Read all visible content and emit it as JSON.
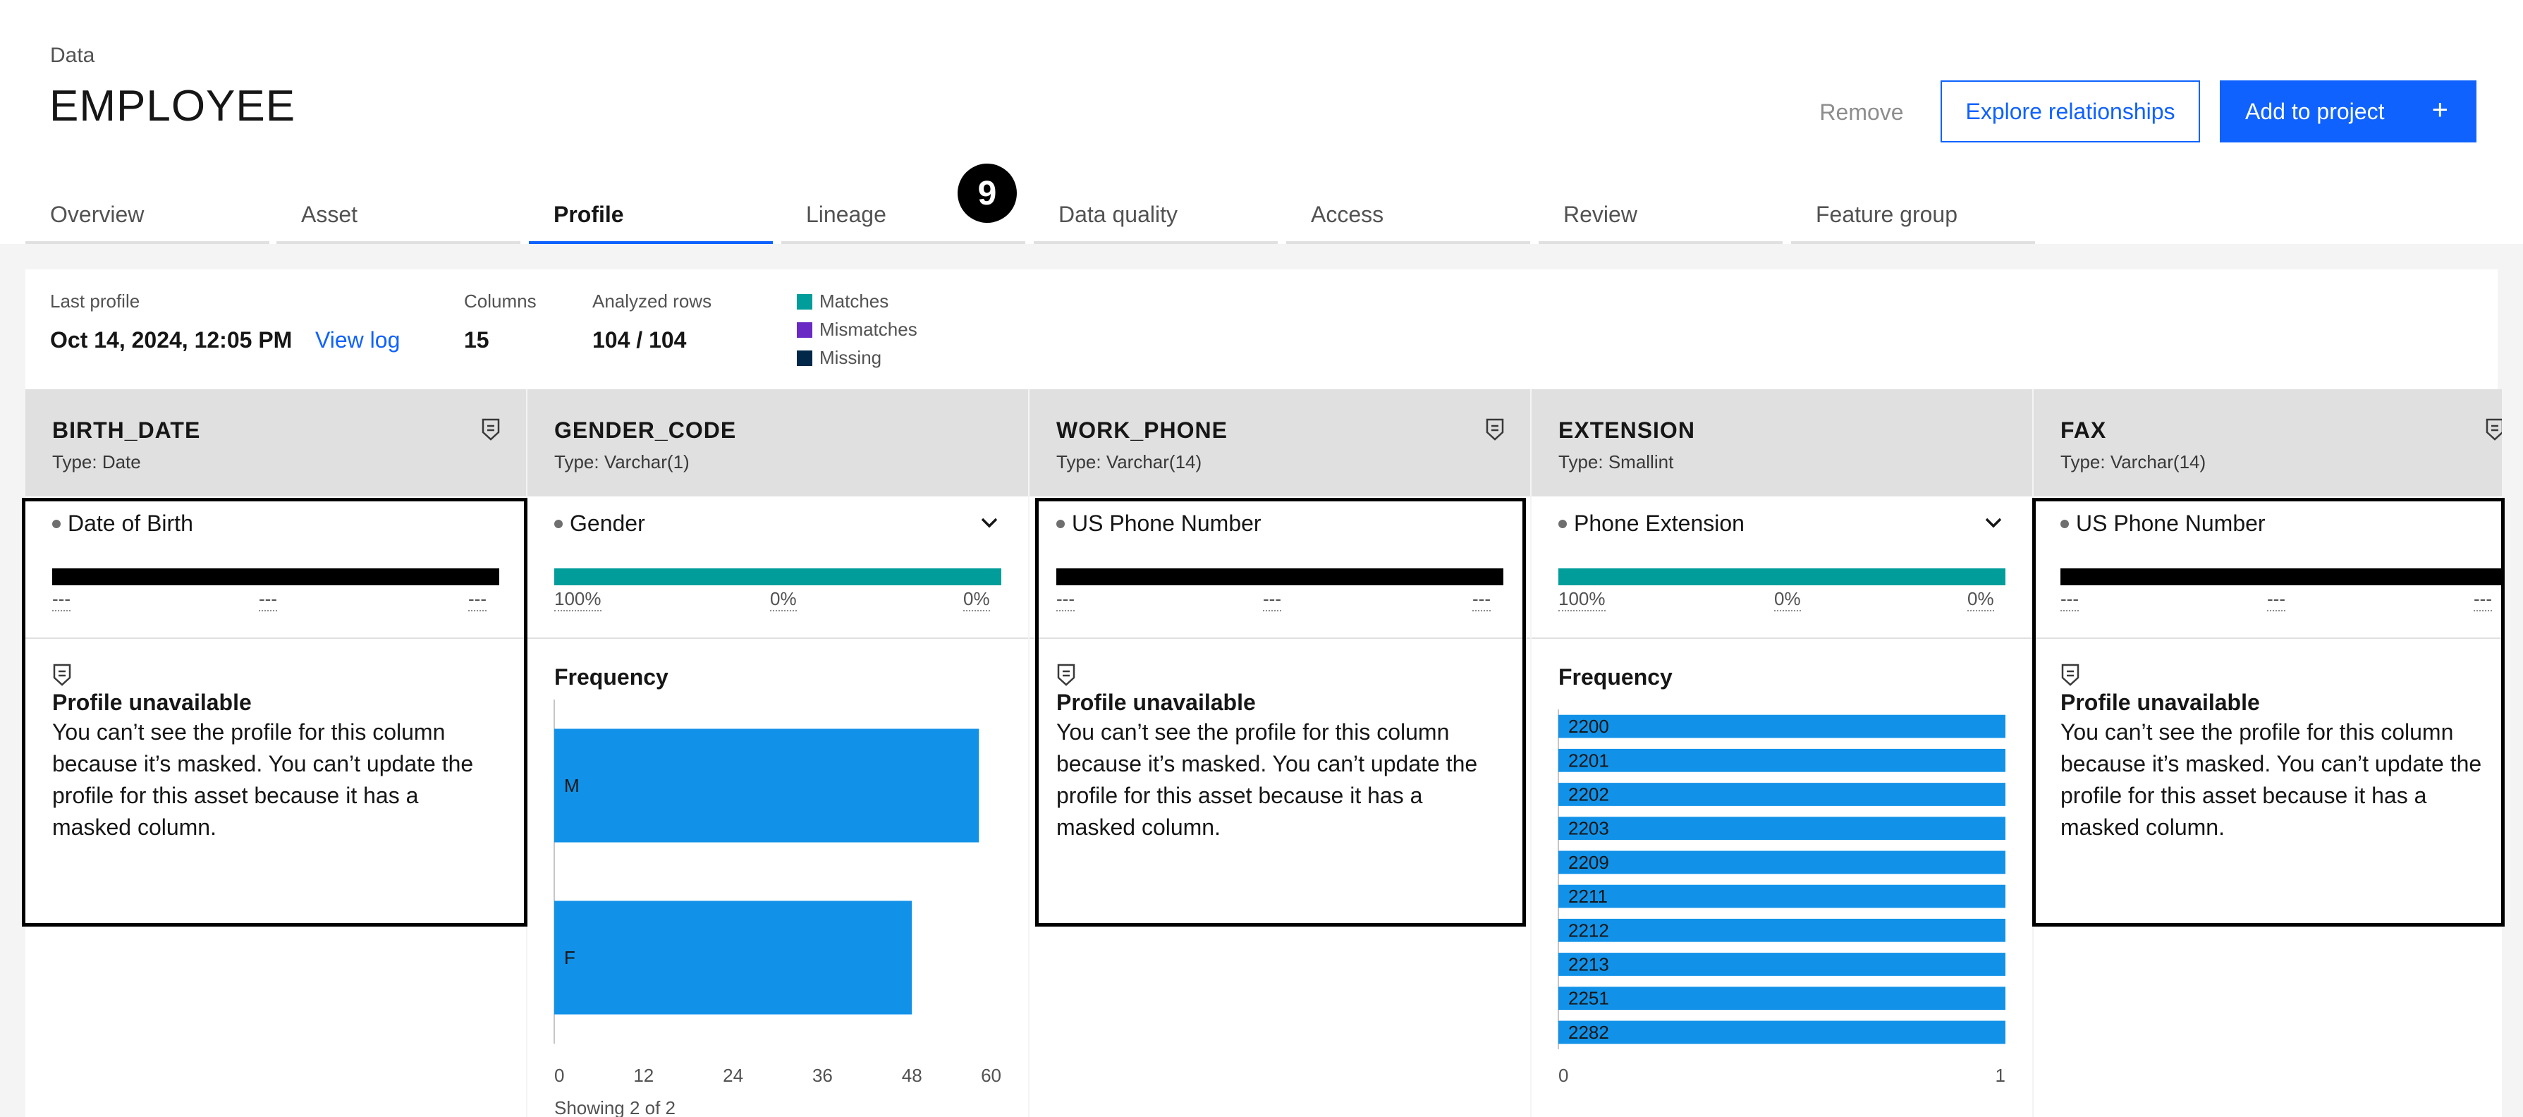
{
  "header": {
    "breadcrumb": "Data",
    "title": "EMPLOYEE",
    "remove_label": "Remove",
    "explore_label": "Explore relationships",
    "add_label": "Add to project",
    "add_icon": "+"
  },
  "tabs": [
    "Overview",
    "Asset",
    "Profile",
    "Lineage",
    "Data quality",
    "Access",
    "Review",
    "Feature group"
  ],
  "active_tab": "Profile",
  "step_badge": "9",
  "summary": {
    "last_profile_label": "Last profile",
    "last_profile_value": "Oct 14, 2024, 12:05 PM",
    "view_log_label": "View log",
    "columns_label": "Columns",
    "columns_value": "15",
    "analyzed_label": "Analyzed rows",
    "analyzed_value": "104 / 104",
    "legend": [
      {
        "label": "Matches",
        "color": "#009d9a"
      },
      {
        "label": "Mismatches",
        "color": "#6929c4"
      },
      {
        "label": "Missing",
        "color": "#012749"
      }
    ]
  },
  "columns": [
    {
      "name": "BIRTH_DATE",
      "type": "Type: Date",
      "classification": "Date of Birth",
      "match": "---",
      "mismatch": "---",
      "missing": "---",
      "masked_title": "Profile unavailable",
      "masked_body": "You can’t see the profile for this column because it’s masked. You can’t update the profile for this asset because it has a masked column."
    },
    {
      "name": "GENDER_CODE",
      "type": "Type: Varchar(1)",
      "classification": "Gender",
      "match": "100%",
      "mismatch": "0%",
      "missing": "0%",
      "frequency_label": "Frequency",
      "showing": "Showing 2 of 2"
    },
    {
      "name": "WORK_PHONE",
      "type": "Type: Varchar(14)",
      "classification": "US Phone Number",
      "match": "---",
      "mismatch": "---",
      "missing": "---",
      "masked_title": "Profile unavailable",
      "masked_body": "You can’t see the profile for this column because it’s masked. You can’t update the profile for this asset because it has a masked column."
    },
    {
      "name": "EXTENSION",
      "type": "Type: Smallint",
      "classification": "Phone Extension",
      "match": "100%",
      "mismatch": "0%",
      "missing": "0%",
      "frequency_label": "Frequency"
    },
    {
      "name": "FAX",
      "type": "Type: Varchar(14)",
      "classification": "US Phone Number",
      "match": "---",
      "mismatch": "---",
      "missing": "---",
      "masked_title": "Profile unavailable",
      "masked_body": "You can’t see the profile for this column because it’s masked. You can’t update the profile for this asset because it has a masked column."
    }
  ],
  "chart_data": [
    {
      "type": "bar",
      "orientation": "horizontal",
      "categories": [
        "M",
        "F"
      ],
      "values": [
        57,
        48
      ],
      "xlim": [
        0,
        60
      ],
      "xticks": [
        "0",
        "12",
        "24",
        "36",
        "48",
        "60"
      ],
      "color": "#1192e8"
    },
    {
      "type": "bar",
      "orientation": "horizontal",
      "categories": [
        "2200",
        "2201",
        "2202",
        "2203",
        "2209",
        "2211",
        "2212",
        "2213",
        "2251",
        "2282"
      ],
      "values": [
        1,
        1,
        1,
        1,
        1,
        1,
        1,
        1,
        1,
        1
      ],
      "xlim": [
        0,
        1
      ],
      "xticks": [
        "0",
        "1"
      ],
      "color": "#1192e8"
    }
  ]
}
